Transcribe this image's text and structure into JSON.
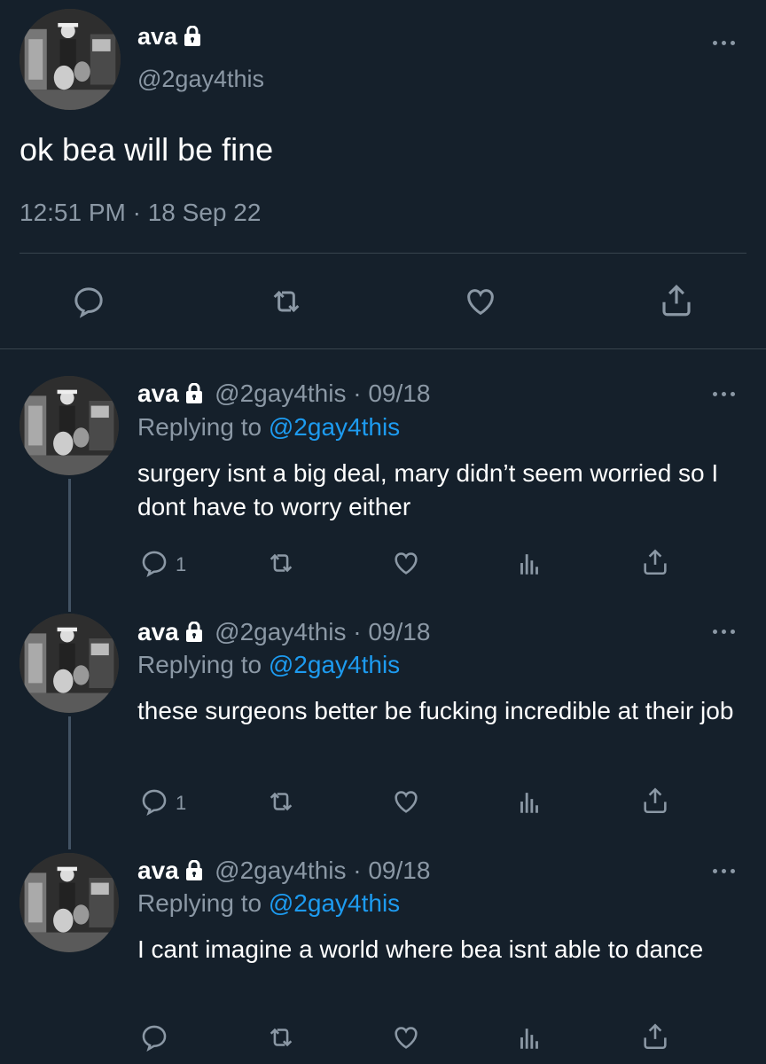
{
  "main_tweet": {
    "name": "ava",
    "handle": "@2gay4this",
    "text": "ok bea will be fine",
    "timestamp": "12:51 PM · 18 Sep 22"
  },
  "replies": [
    {
      "name": "ava",
      "handle_date": "@2gay4this · 09/18",
      "replying_prefix": "Replying to ",
      "replying_to": "@2gay4this",
      "text": "surgery isnt a big deal, mary didn’t seem worried so I dont have to worry either",
      "reply_count": "1"
    },
    {
      "name": "ava",
      "handle_date": "@2gay4this · 09/18",
      "replying_prefix": "Replying to ",
      "replying_to": "@2gay4this",
      "text": "these surgeons better be fucking incredible at their job",
      "reply_count": "1"
    },
    {
      "name": "ava",
      "handle_date": "@2gay4this · 09/18",
      "replying_prefix": "Replying to ",
      "replying_to": "@2gay4this",
      "text": "I cant imagine a world where bea isnt able to dance",
      "reply_count": ""
    }
  ],
  "colors": {
    "background": "#15202b",
    "text_primary": "#ffffff",
    "text_secondary": "#8b98a5",
    "link": "#1d9bf0",
    "divider": "#38444d"
  },
  "icons": [
    "lock-icon",
    "more-icon",
    "reply-icon",
    "retweet-icon",
    "like-icon",
    "share-icon",
    "analytics-icon"
  ]
}
